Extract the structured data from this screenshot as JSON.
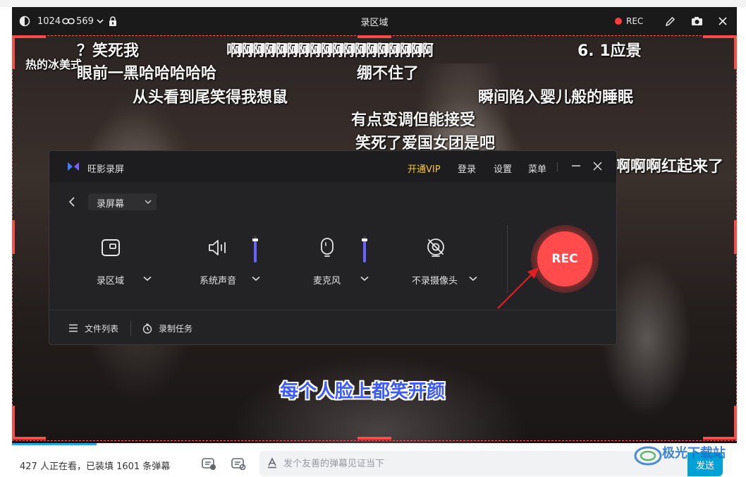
{
  "capture_bar": {
    "resolution_width": "1024",
    "resolution_height": "569",
    "title": "录区域",
    "rec_label": "REC"
  },
  "danmaku": [
    "？笑死我",
    "热的冰美式",
    "眼前一黑哈哈哈哈哈",
    "啊啊啊啊啊啊啊啊啊啊啊啊啊啊啊啊啊啊",
    "6. 1应景",
    "绷不住了",
    "从头看到尾笑得我想鼠",
    "瞬间陷入婴儿般的睡眠",
    "有点变调但能接受",
    "笑死了爱国女团是吧",
    "啊啊啊红起来了"
  ],
  "subtitle": "每个人脸上都笑开颜",
  "recorder": {
    "app_name": "旺影录屏",
    "menu": {
      "vip": "开通VIP",
      "login": "登录",
      "settings": "设置",
      "menu": "菜单"
    },
    "mode_select": "录屏幕",
    "controls": {
      "region": "录区域",
      "system_audio": "系统声音",
      "microphone": "麦克风",
      "camera": "不录摄像头"
    },
    "system_audio_level": 0.85,
    "microphone_level": 0.85,
    "rec_button": "REC",
    "footer": {
      "file_list": "文件列表",
      "record_task": "录制任务"
    },
    "accent_color": "#6a63ff",
    "rec_color": "#ff4b4b"
  },
  "bottom_bar": {
    "viewers_text": "427 人正在看，已装填 1601 条弹幕",
    "chat_placeholder": "发个友善的弹幕见证当下",
    "send_label": "发送"
  },
  "watermark": {
    "brand": "极光下载站"
  }
}
